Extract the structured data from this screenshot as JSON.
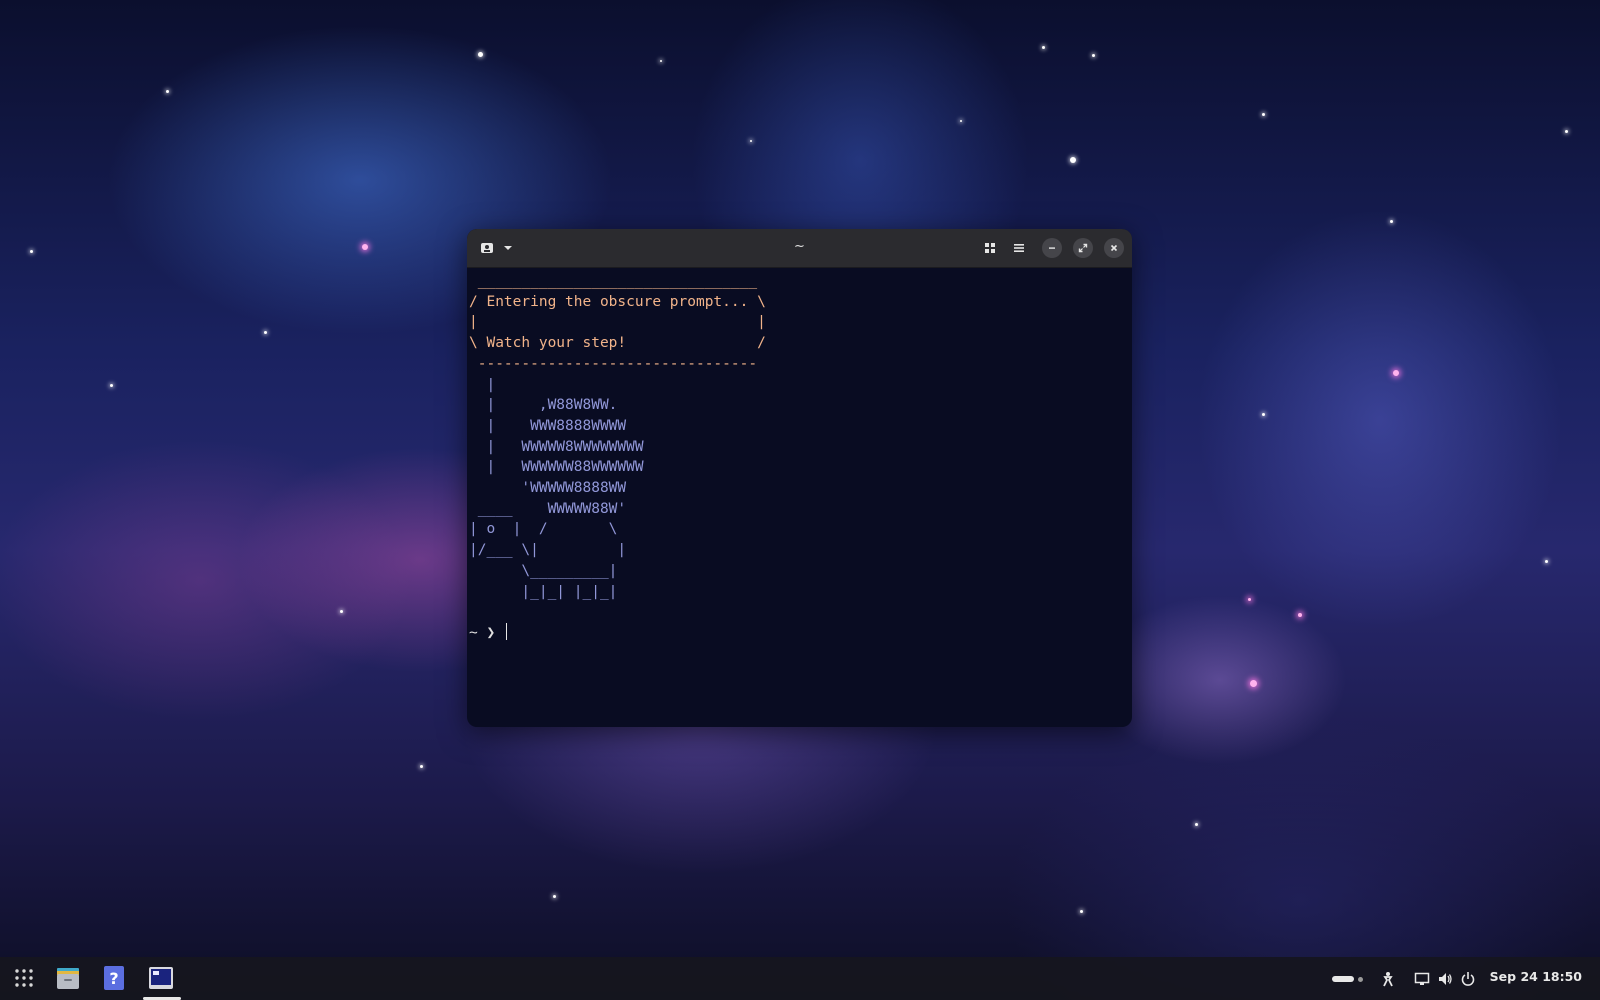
{
  "window": {
    "title": "~",
    "terminal_lines": [
      {
        "cls": "bubble",
        "text": " ________________________________"
      },
      {
        "cls": "bubble",
        "text": "/ Entering the obscure prompt... \\"
      },
      {
        "cls": "bubble",
        "text": "|                                |"
      },
      {
        "cls": "bubble",
        "text": "\\ Watch your step!               /"
      },
      {
        "cls": "bubble",
        "text": " --------------------------------"
      },
      {
        "cls": "art",
        "text": "  |"
      },
      {
        "cls": "art",
        "text": "  |     ,W88W8WW."
      },
      {
        "cls": "art",
        "text": "  |    WWW8888WWWW"
      },
      {
        "cls": "art",
        "text": "  |   WWWWW8WWWWWWWW"
      },
      {
        "cls": "art",
        "text": "  |   WWWWWW88WWWWWW"
      },
      {
        "cls": "art",
        "text": "      'WWWWW8888WW"
      },
      {
        "cls": "art",
        "text": " ____    WWWWW88W'"
      },
      {
        "cls": "art",
        "text": "| o  |  /       \\"
      },
      {
        "cls": "art",
        "text": "|/___ \\|         |"
      },
      {
        "cls": "art",
        "text": "      \\_________|"
      },
      {
        "cls": "art",
        "text": "      |_|_| |_|_|"
      },
      {
        "cls": "art",
        "text": ""
      }
    ],
    "prompt": "~ ❯ "
  },
  "icons": {
    "new_tab": "new-tab-icon",
    "dropdown": "chevron-down-icon",
    "grid": "grid-icon",
    "menu": "hamburger-menu-icon",
    "minimize": "minimize-icon",
    "maximize": "maximize-icon",
    "close": "close-icon"
  },
  "taskbar": {
    "apps": [
      "app-grid-icon",
      "files-icon",
      "help-icon",
      "terminal-icon"
    ],
    "tray": [
      "workspace-indicator",
      "accessibility-icon",
      "display-icon",
      "volume-icon",
      "power-icon"
    ],
    "clock": "Sep 24  18:50"
  },
  "colors": {
    "bubble_text": "#f1b38a",
    "art_text": "#9197d8",
    "terminal_bg": "#090c22",
    "titlebar_bg": "#2b2b2f"
  }
}
